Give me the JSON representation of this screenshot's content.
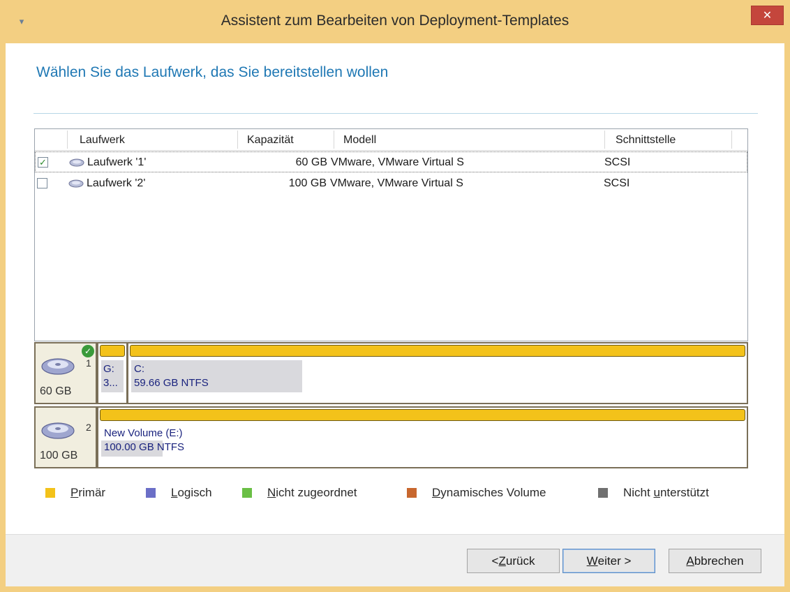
{
  "window": {
    "title": "Assistent zum Bearbeiten von Deployment-Templates",
    "close_glyph": "✕",
    "menu_glyph": "▾"
  },
  "page": {
    "heading": "Wählen Sie das Laufwerk, das Sie bereitstellen wollen"
  },
  "drive_list": {
    "columns": [
      "Laufwerk",
      "Kapazität",
      "Modell",
      "Schnittstelle"
    ],
    "rows": [
      {
        "checked": true,
        "name": "Laufwerk '1'",
        "capacity": "60 GB",
        "model": "VMware, VMware Virtual S",
        "interface": "SCSI"
      },
      {
        "checked": false,
        "name": "Laufwerk '2'",
        "capacity": "100 GB",
        "model": "VMware, VMware Virtual S",
        "interface": "SCSI"
      }
    ],
    "check_glyph": "✓"
  },
  "disk_map": {
    "disks": [
      {
        "number": "1",
        "size": "60 GB",
        "status_glyph": "✓",
        "partitions": [
          {
            "line1": "G:",
            "line2": "3..."
          },
          {
            "line1": "C:",
            "line2": "59.66 GB  NTFS"
          }
        ]
      },
      {
        "number": "2",
        "size": "100 GB",
        "partitions": [
          {
            "line1": "New Volume (E:)",
            "line2": "100.00 GB  NTFS"
          }
        ]
      }
    ]
  },
  "legend": {
    "items": [
      {
        "pre": "",
        "key": "P",
        "post": "rimär",
        "color": "#f3c21a"
      },
      {
        "pre": "",
        "key": "L",
        "post": "ogisch",
        "color": "#6b6fc7"
      },
      {
        "pre": "",
        "key": "N",
        "post": "icht zugeordnet",
        "color": "#6abf45"
      },
      {
        "pre": "",
        "key": "D",
        "post": "ynamisches Volume",
        "color": "#c8672e"
      },
      {
        "pre": "Nicht ",
        "key": "u",
        "post": "nterstützt",
        "color": "#707070"
      }
    ]
  },
  "buttons": {
    "back": {
      "pre": "< ",
      "key": "Z",
      "post": "urück"
    },
    "next": {
      "pre": "",
      "key": "W",
      "post": "eiter >"
    },
    "cancel": {
      "pre": "",
      "key": "A",
      "post": "bbrechen"
    }
  }
}
